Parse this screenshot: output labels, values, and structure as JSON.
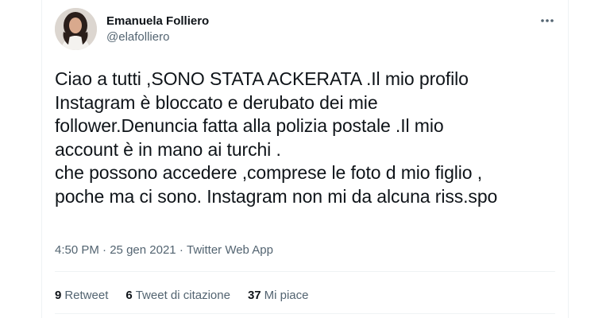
{
  "author": {
    "display_name": "Emanuela Folliero",
    "handle": "@elafolliero"
  },
  "tweet": {
    "text": "Ciao a tutti ,SONO STATA ACKERATA .Il mio profilo\nInstagram è bloccato e derubato dei mie\nfollower.Denuncia fatta alla polizia postale .Il mio\naccount è in mano ai turchi .\nche possono accedere ,comprese le foto d mio figlio ,\npoche ma ci sono. Instagram non mi da alcuna riss.spo"
  },
  "meta": {
    "time": "4:50 PM",
    "separator": "·",
    "date": "25 gen 2021",
    "source": "Twitter Web App"
  },
  "stats": {
    "retweets_count": "9",
    "retweets_label": "Retweet",
    "quotes_count": "6",
    "quotes_label": "Tweet di citazione",
    "likes_count": "37",
    "likes_label": "Mi piace"
  },
  "icons": {
    "more": "more-horizontal-icon"
  },
  "colors": {
    "text_primary": "#0f1419",
    "text_secondary": "#536471",
    "divider": "#eff3f4"
  }
}
